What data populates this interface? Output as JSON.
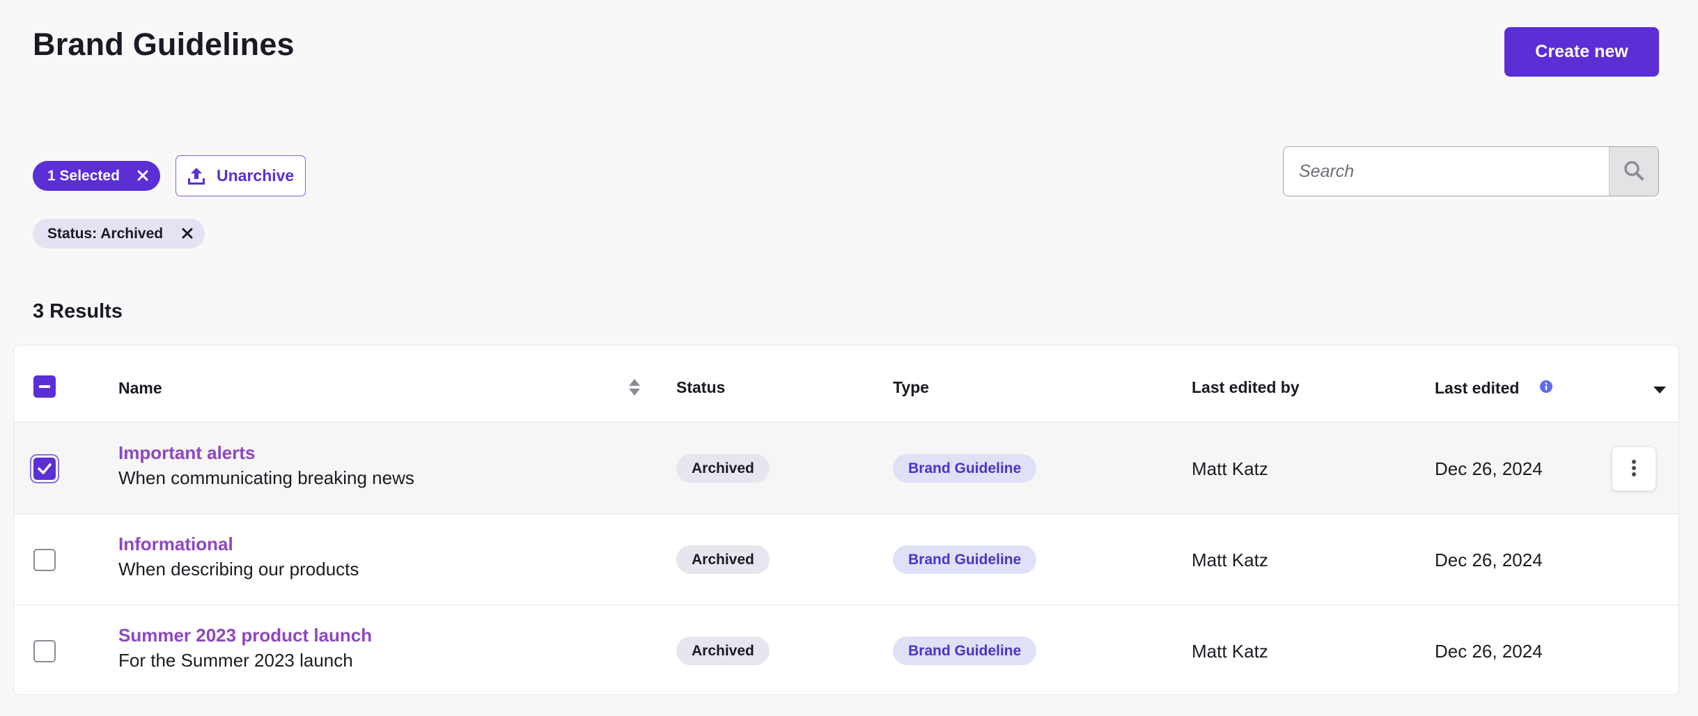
{
  "header": {
    "title": "Brand Guidelines",
    "create_label": "Create new"
  },
  "toolbar": {
    "selected_label": "1 Selected",
    "unarchive_label": "Unarchive",
    "search_placeholder": "Search",
    "search_value": ""
  },
  "filters": {
    "status_chip_label": "Status: Archived"
  },
  "results": {
    "count_label": "3 Results"
  },
  "table": {
    "columns": {
      "name": "Name",
      "status": "Status",
      "type": "Type",
      "last_edited_by": "Last edited by",
      "last_edited": "Last edited"
    },
    "rows": [
      {
        "title": "Important alerts",
        "description": "When communicating breaking news",
        "status": "Archived",
        "type": "Brand Guideline",
        "edited_by": "Matt Katz",
        "edited_on": "Dec 26, 2024",
        "checked": true
      },
      {
        "title": "Informational",
        "description": "When describing our products",
        "status": "Archived",
        "type": "Brand Guideline",
        "edited_by": "Matt Katz",
        "edited_on": "Dec 26, 2024",
        "checked": false
      },
      {
        "title": "Summer 2023 product launch",
        "description": "For the Summer 2023 launch",
        "status": "Archived",
        "type": "Brand Guideline",
        "edited_by": "Matt Katz",
        "edited_on": "Dec 26, 2024",
        "checked": false
      }
    ]
  },
  "colors": {
    "accent": "#5b2ed6",
    "name_link": "#8f46c0",
    "type_badge_text": "#4636c8",
    "info_icon": "#5b6cf0"
  },
  "icons": {
    "chip_close": "close-icon",
    "unarchive": "upload-tray-icon",
    "search": "search-icon",
    "sort": "sort-icon",
    "info": "info-icon",
    "column_menu": "caret-down-icon",
    "row_actions": "kebab-vertical-icon"
  }
}
